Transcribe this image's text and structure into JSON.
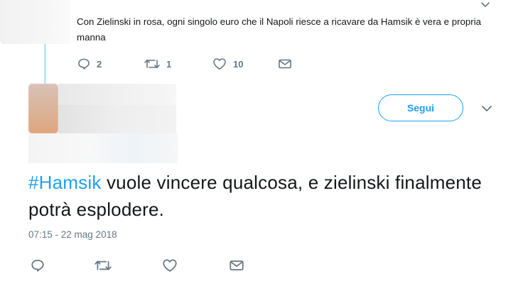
{
  "reply_tweet": {
    "text": "Con Zielinski in rosa, ogni singolo euro che il Napoli riesce a ricavare da Hamsik è vera e propria manna",
    "actions": {
      "reply_count": "2",
      "retweet_count": "1",
      "like_count": "10"
    }
  },
  "main_tweet": {
    "follow_label": "Segui",
    "hashtag": "#Hamsik",
    "text_rest": " vuole vincere qualcosa, e zielinski finalmente potrà esplodere.",
    "timestamp": "07:15 - 22 mag 2018"
  },
  "colors": {
    "accent": "#1da1f2",
    "muted": "#657786",
    "thread_line": "#c4e2f5"
  },
  "icons": [
    "chevron-down-icon",
    "reply-icon",
    "retweet-icon",
    "like-icon",
    "direct-message-icon"
  ]
}
